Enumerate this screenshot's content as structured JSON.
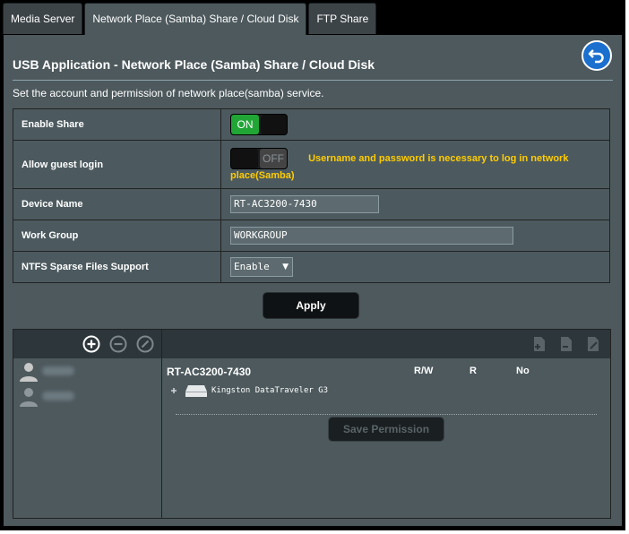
{
  "tabs": [
    {
      "label": "Media Server",
      "active": false
    },
    {
      "label": "Network Place (Samba) Share / Cloud Disk",
      "active": true
    },
    {
      "label": "FTP Share",
      "active": false
    }
  ],
  "page_title": "USB Application - Network Place (Samba) Share / Cloud Disk",
  "description": "Set the account and permission of network place(samba) service.",
  "form": {
    "enable_share": {
      "label": "Enable Share",
      "state": "ON"
    },
    "allow_guest": {
      "label": "Allow guest login",
      "state": "OFF",
      "note": "Username and password is necessary to log in network place(Samba)"
    },
    "device_name": {
      "label": "Device Name",
      "value": "RT-AC3200-7430"
    },
    "work_group": {
      "label": "Work Group",
      "value": "WORKGROUP"
    },
    "ntfs_sparse": {
      "label": "NTFS Sparse Files Support",
      "value": "Enable"
    }
  },
  "apply_label": "Apply",
  "permissions": {
    "share_name": "RT-AC3200-7430",
    "columns": [
      "R/W",
      "R",
      "No"
    ],
    "disk": "Kingston DataTraveler G3",
    "save_label": "Save Permission"
  },
  "colors": {
    "accent_on": "#21a636",
    "warning": "#ffcc00",
    "panel": "#4d595d"
  }
}
